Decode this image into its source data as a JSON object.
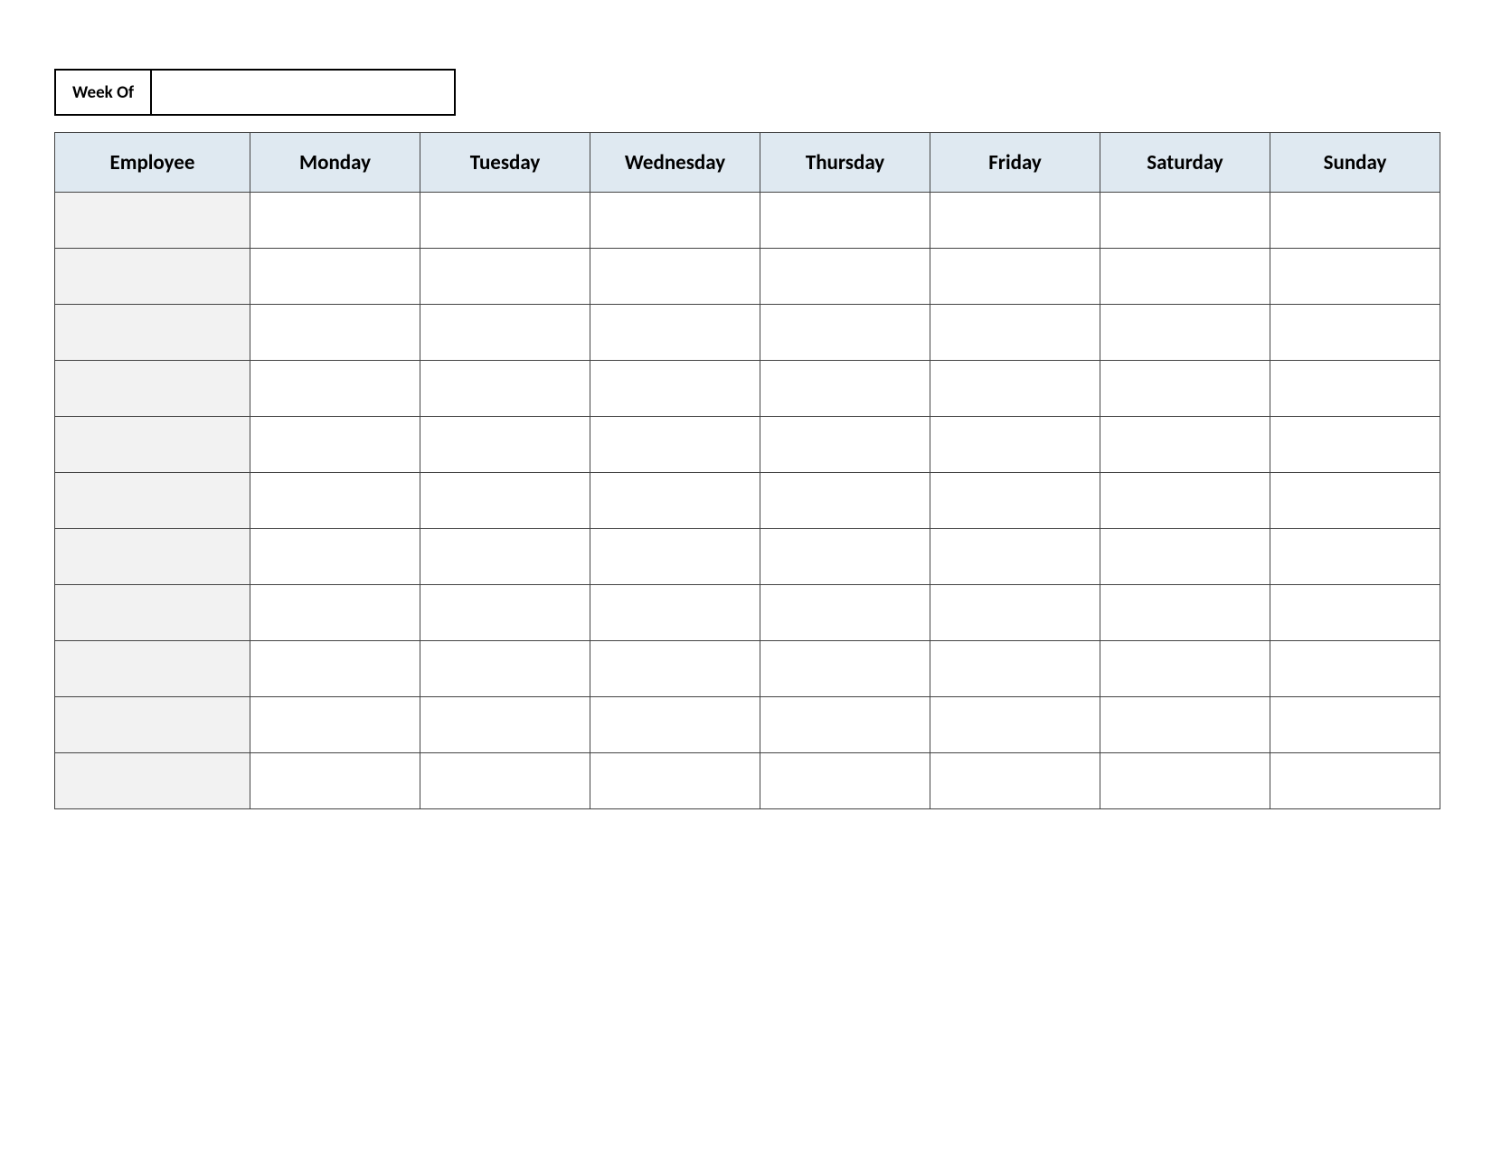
{
  "week_of": {
    "label": "Week Of",
    "value": ""
  },
  "headers": {
    "employee": "Employee",
    "days": [
      "Monday",
      "Tuesday",
      "Wednesday",
      "Thursday",
      "Friday",
      "Saturday",
      "Sunday"
    ]
  },
  "rows": [
    {
      "employee": "",
      "days": [
        "",
        "",
        "",
        "",
        "",
        "",
        ""
      ]
    },
    {
      "employee": "",
      "days": [
        "",
        "",
        "",
        "",
        "",
        "",
        ""
      ]
    },
    {
      "employee": "",
      "days": [
        "",
        "",
        "",
        "",
        "",
        "",
        ""
      ]
    },
    {
      "employee": "",
      "days": [
        "",
        "",
        "",
        "",
        "",
        "",
        ""
      ]
    },
    {
      "employee": "",
      "days": [
        "",
        "",
        "",
        "",
        "",
        "",
        ""
      ]
    },
    {
      "employee": "",
      "days": [
        "",
        "",
        "",
        "",
        "",
        "",
        ""
      ]
    },
    {
      "employee": "",
      "days": [
        "",
        "",
        "",
        "",
        "",
        "",
        ""
      ]
    },
    {
      "employee": "",
      "days": [
        "",
        "",
        "",
        "",
        "",
        "",
        ""
      ]
    },
    {
      "employee": "",
      "days": [
        "",
        "",
        "",
        "",
        "",
        "",
        ""
      ]
    },
    {
      "employee": "",
      "days": [
        "",
        "",
        "",
        "",
        "",
        "",
        ""
      ]
    },
    {
      "employee": "",
      "days": [
        "",
        "",
        "",
        "",
        "",
        "",
        ""
      ]
    }
  ]
}
